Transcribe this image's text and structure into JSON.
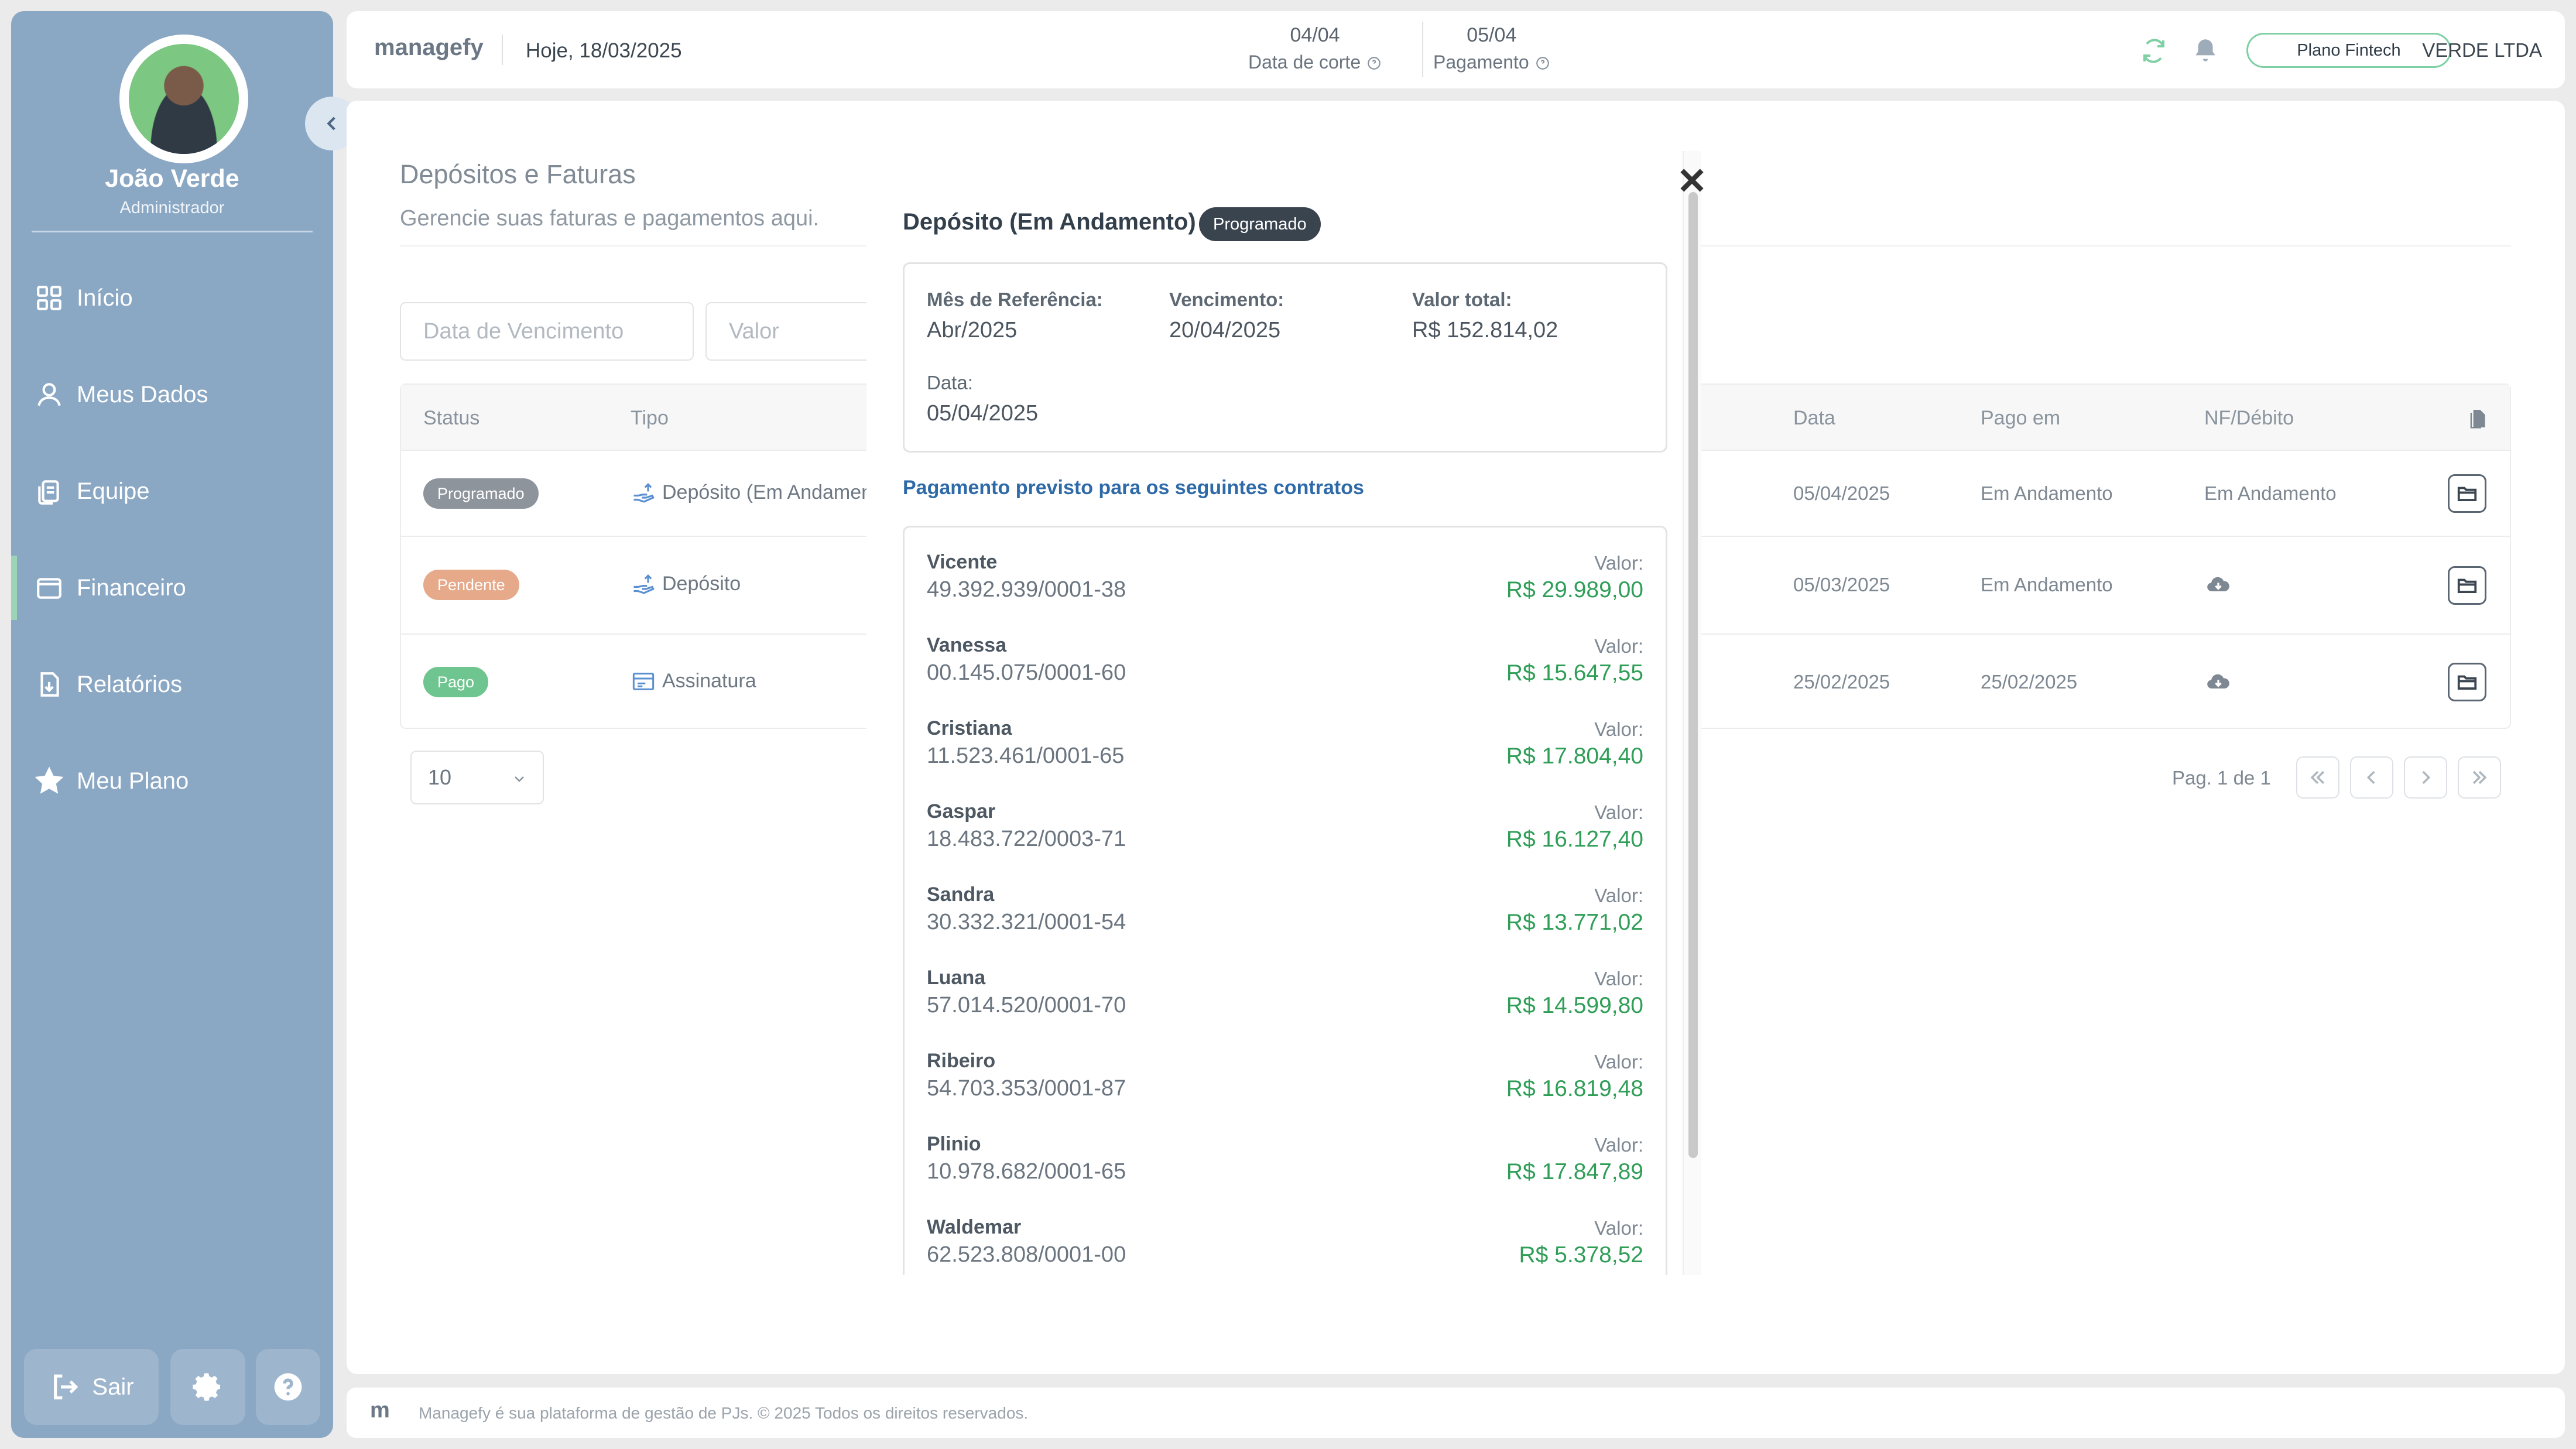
{
  "user": {
    "name": "João Verde",
    "role": "Administrador"
  },
  "nav": [
    {
      "label": "Início",
      "icon": "grid-icon"
    },
    {
      "label": "Meus Dados",
      "icon": "user-icon"
    },
    {
      "label": "Equipe",
      "icon": "document-copy-icon"
    },
    {
      "label": "Financeiro",
      "icon": "wallet-icon"
    },
    {
      "label": "Relatórios",
      "icon": "report-icon"
    },
    {
      "label": "Meu Plano",
      "icon": "star-icon"
    }
  ],
  "sidebar_footer": {
    "logout_label": "Sair"
  },
  "header": {
    "brand": "managefy",
    "today": "Hoje, 18/03/2025",
    "cutoff_date": "04/04",
    "cutoff_label": "Data de corte",
    "payment_date": "05/04",
    "payment_label": "Pagamento",
    "plan": "Plano Fintech",
    "company": "VERDE LTDA"
  },
  "page": {
    "title": "Depósitos e Faturas",
    "subtitle": "Gerencie suas faturas e pagamentos aqui.",
    "filters": {
      "due_date_placeholder": "Data de Vencimento",
      "value_placeholder": "Valor"
    }
  },
  "table": {
    "columns": {
      "status": "Status",
      "type": "Tipo",
      "date": "Data",
      "paid_on": "Pago em",
      "nf": "NF/Débito"
    },
    "rows": [
      {
        "status": "Programado",
        "status_color": "#8e949b",
        "type": "Depósito (Em Andamento)",
        "type_icon": "deposit-icon",
        "date": "05/04/2025",
        "paid_on": "Em Andamento",
        "nf": "Em Andamento"
      },
      {
        "status": "Pendente",
        "status_color": "#e6a98a",
        "type": "Depósito",
        "type_icon": "deposit-icon",
        "date": "05/03/2025",
        "paid_on": "Em Andamento",
        "nf": ""
      },
      {
        "status": "Pago",
        "status_color": "#6fc58f",
        "type": "Assinatura",
        "type_icon": "invoice-icon",
        "date": "25/02/2025",
        "paid_on": "25/02/2025",
        "nf": ""
      }
    ]
  },
  "pagination": {
    "per_page": "10",
    "info": "Pag. 1 de 1"
  },
  "footer": {
    "logo": "m",
    "text": "Managefy é sua plataforma de gestão de PJs. © 2025 Todos os direitos reservados."
  },
  "modal": {
    "title": "Depósito (Em Andamento)",
    "badge": "Programado",
    "ref_month_label": "Mês de Referência:",
    "ref_month": "Abr/2025",
    "due_label": "Vencimento:",
    "due": "20/04/2025",
    "total_label": "Valor total:",
    "total": "R$ 152.814,02",
    "date_label": "Data:",
    "date": "05/04/2025",
    "contracts_title": "Pagamento previsto para os seguintes contratos",
    "value_label": "Valor:",
    "contracts": [
      {
        "name": "Vicente",
        "cnpj": "49.392.939/0001-38",
        "value": "R$ 29.989,00"
      },
      {
        "name": "Vanessa",
        "cnpj": "00.145.075/0001-60",
        "value": "R$ 15.647,55"
      },
      {
        "name": "Cristiana",
        "cnpj": "11.523.461/0001-65",
        "value": "R$ 17.804,40"
      },
      {
        "name": "Gaspar",
        "cnpj": "18.483.722/0003-71",
        "value": "R$ 16.127,40"
      },
      {
        "name": "Sandra",
        "cnpj": "30.332.321/0001-54",
        "value": "R$ 13.771,02"
      },
      {
        "name": "Luana",
        "cnpj": "57.014.520/0001-70",
        "value": "R$ 14.599,80"
      },
      {
        "name": "Ribeiro",
        "cnpj": "54.703.353/0001-87",
        "value": "R$ 16.819,48"
      },
      {
        "name": "Plinio",
        "cnpj": "10.978.682/0001-65",
        "value": "R$ 17.847,89"
      },
      {
        "name": "Waldemar",
        "cnpj": "62.523.808/0001-00",
        "value": "R$ 5.378,52"
      }
    ]
  }
}
